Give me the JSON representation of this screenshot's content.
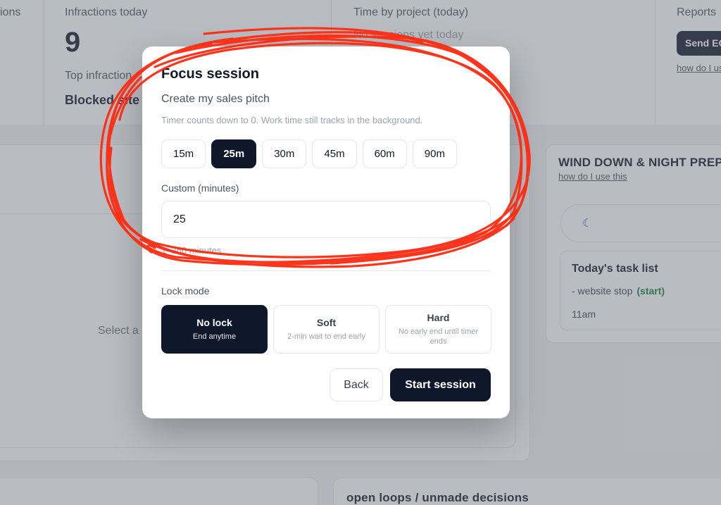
{
  "stats": {
    "col1_label": "ions",
    "infractions_label": "Infractions today",
    "infractions_value": "9",
    "top_infraction_label": "Top infraction",
    "top_infraction_value": "Blocked site",
    "time_by_project_label": "Time by project (today)",
    "no_sessions_text": "No sessions yet today",
    "reports_label": "Reports",
    "send_button": "Send EOD",
    "reports_link": "how do I use this"
  },
  "background": {
    "select_text": "Select a",
    "wind_down_title": "WIND DOWN & NIGHT PREP",
    "wind_down_link": "how do I use this",
    "task_list_title": "Today's task list",
    "task_item": "- website stop",
    "task_item_action": "(start)",
    "task_time": "11am",
    "open_loops_title": "open loops / unmade decisions"
  },
  "modal": {
    "title": "Focus session",
    "subtitle": "Create my sales pitch",
    "hint": "Timer counts down to 0. Work time still tracks in the background.",
    "presets": [
      "15m",
      "25m",
      "30m",
      "45m",
      "60m",
      "90m"
    ],
    "selected_preset": "25m",
    "custom_label": "Custom (minutes)",
    "custom_value": "25",
    "range_hint": "1–360 minutes",
    "lock_mode_label": "Lock mode",
    "lock_modes": [
      {
        "title": "No lock",
        "desc": "End anytime"
      },
      {
        "title": "Soft",
        "desc": "2-min wait to end early"
      },
      {
        "title": "Hard",
        "desc": "No early end until timer ends"
      }
    ],
    "selected_lock": "No lock",
    "back_button": "Back",
    "start_button": "Start session"
  },
  "colors": {
    "primary": "#0f172a",
    "annotation": "#ff2a10",
    "success": "#15803d",
    "accent_icon": "#4f46e5"
  },
  "icons": {
    "moon": "moon-icon"
  }
}
